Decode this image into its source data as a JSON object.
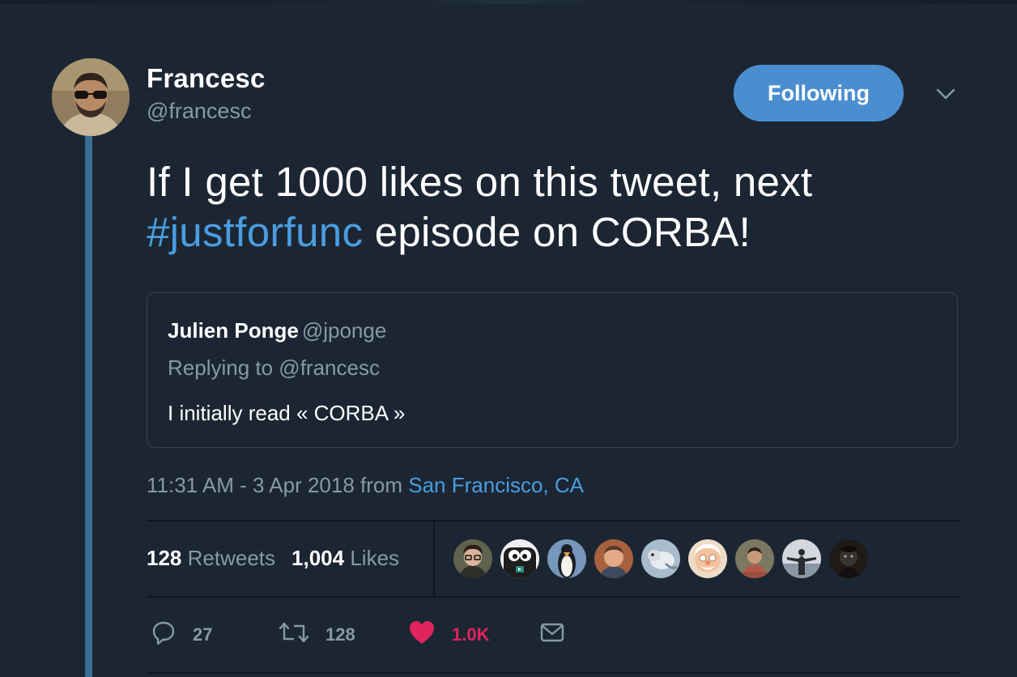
{
  "author": {
    "display_name": "Francesc",
    "handle": "@francesc",
    "avatar_icon": "person-with-sunglasses-avatar"
  },
  "follow_button": {
    "label": "Following"
  },
  "menu": {
    "icon": "chevron-down-icon"
  },
  "tweet": {
    "text_before": "If I get 1000 likes on this tweet, next ",
    "hashtag": "#justforfunc",
    "text_after": " episode on CORBA!"
  },
  "quoted": {
    "name": "Julien Ponge",
    "handle": "@jponge",
    "replying_to": "Replying to @francesc",
    "body": "I initially read « CORBA »"
  },
  "meta": {
    "time_date": "11:31 AM - 3 Apr 2018 from ",
    "location": "San Francisco, CA"
  },
  "stats": {
    "retweets_count": "128",
    "retweets_label": "Retweets",
    "likes_count": "1,004",
    "likes_label": "Likes"
  },
  "likers": [
    {
      "icon": "user-avatar-glasses",
      "bg": "#6b6e5a"
    },
    {
      "icon": "gopher-avatar",
      "bg": "#e9ecef"
    },
    {
      "icon": "penguin-avatar",
      "bg": "#6f8fb5"
    },
    {
      "icon": "user-avatar-man",
      "bg": "#b06a47"
    },
    {
      "icon": "user-avatar-animal",
      "bg": "#9fb2c4"
    },
    {
      "icon": "cartoon-face-avatar",
      "bg": "#e8c6a6"
    },
    {
      "icon": "user-avatar-plaid",
      "bg": "#7c7a63"
    },
    {
      "icon": "user-avatar-outdoors",
      "bg": "#c8ccd2"
    },
    {
      "icon": "user-avatar-dark",
      "bg": "#2a2522"
    }
  ],
  "actions": {
    "reply_count": "27",
    "retweet_count": "128",
    "like_count": "1.0K"
  },
  "colors": {
    "background": "#1c2633",
    "accent": "#4a9de0",
    "button": "#4b8ed0",
    "muted": "#8899a6",
    "like": "#e0245e",
    "thread_line": "#3a6d96"
  }
}
